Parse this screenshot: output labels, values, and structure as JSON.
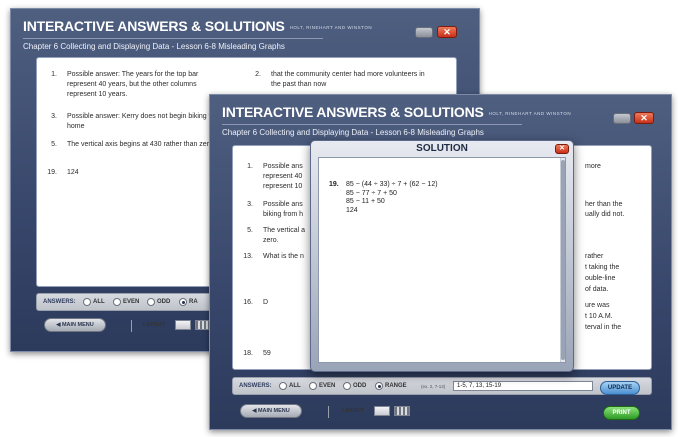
{
  "app": {
    "title": "INTERACTIVE ANSWERS & SOLUTIONS",
    "publisher": "HOLT, RINEHART AND WINSTON",
    "chapter": "Chapter 6 Collecting and Displaying Data - Lesson 6-8 Misleading Graphs",
    "close_icon_glyph": "✕"
  },
  "back_window": {
    "left_answers": [
      {
        "num": "1.",
        "text": "Possible answer: The years for the top bar represent 40 years, but the other columns represent 10 years."
      },
      {
        "num": "3.",
        "text": "Possible answer: Kerry does not begin biking from home"
      },
      {
        "num": "5.",
        "text": "The vertical axis begins at 430 rather than zero."
      },
      {
        "num": "19.",
        "text": "124"
      }
    ],
    "right_answers": [
      {
        "num": "2.",
        "text": "that the community center had more volunteers in the past than now"
      }
    ]
  },
  "front_window": {
    "left_answers": [
      {
        "num": "1.",
        "text": "Possible ans"
      },
      {
        "num": "",
        "text": "represent 40"
      },
      {
        "num": "",
        "text": "represent 10"
      },
      {
        "num": "3.",
        "text": "Possible ans"
      },
      {
        "num": "",
        "text": "biking from h"
      },
      {
        "num": "5.",
        "text": "The vertical a"
      },
      {
        "num": "",
        "text": "zero."
      },
      {
        "num": "13.",
        "text": "What is the n"
      },
      {
        "num": "16.",
        "text": "D"
      },
      {
        "num": "18.",
        "text": "59"
      }
    ],
    "right_fragments": [
      "more",
      "her than the",
      "ually did not.",
      "rather",
      "t taking the",
      "ouble-line",
      "of data.",
      "ure was",
      "t 10 A.M.",
      "terval in the"
    ]
  },
  "controls": {
    "answers_label": "ANSWERS:",
    "options": [
      "ALL",
      "EVEN",
      "ODD",
      "RANGE"
    ],
    "back_truncated_option": "RA",
    "selected": "RANGE",
    "range_note": "(ex. 2, 7-13)",
    "range_value": "1-5, 7, 13, 15-19",
    "update_label": "UPDATE",
    "main_menu_label": "◀ MAIN MENU",
    "layout_label": "LAYOUT",
    "print_label": "PRINT"
  },
  "solution": {
    "title": "SOLUTION",
    "problem_num": "19.",
    "lines": [
      "85 − (44 ÷ 33) ÷ 7 + (62 − 12)",
      "85 − 77 ÷ 7 + 50",
      "85 − 11 + 50",
      "124"
    ]
  }
}
